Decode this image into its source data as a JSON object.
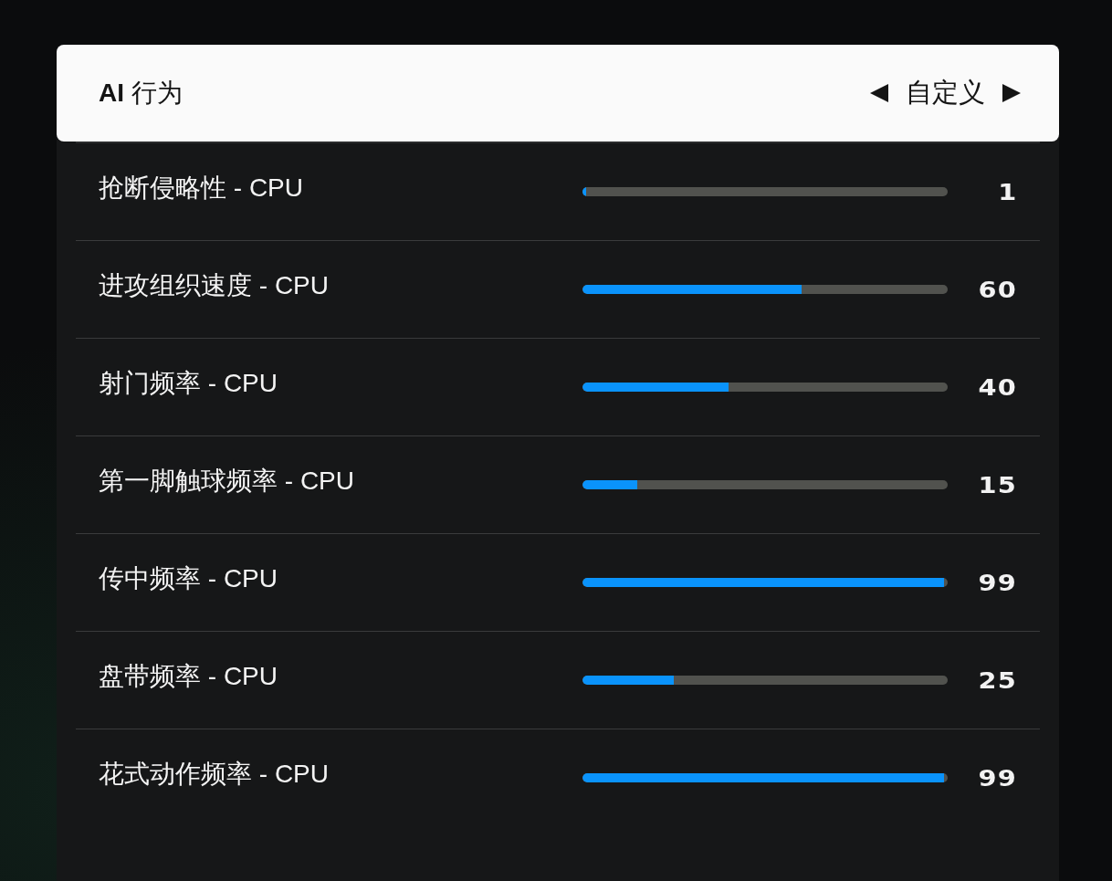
{
  "header": {
    "title": "**AI** 行为",
    "value": "自定义"
  },
  "settings": [
    {
      "label": "抢断侵略性 - CPU",
      "level": 0.01,
      "reading": "1"
    },
    {
      "label": "进攻组织速度 - CPU",
      "level": 0.6,
      "reading": "60"
    },
    {
      "label": "射门频率 - CPU",
      "level": 0.4,
      "reading": "40"
    },
    {
      "label": "第一脚触球频率 - CPU",
      "level": 0.15,
      "reading": "15"
    },
    {
      "label": "传中频率 - CPU",
      "level": 0.99,
      "reading": "99"
    },
    {
      "label": "盘带频率 - CPU",
      "level": 0.25,
      "reading": "25"
    },
    {
      "label": "花式动作频率 - CPU",
      "level": 0.99,
      "reading": "99"
    }
  ]
}
